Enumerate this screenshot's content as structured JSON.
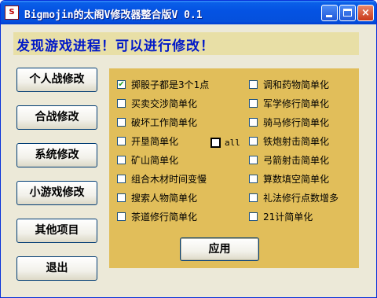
{
  "window": {
    "title": "Bigmojin的太阁V修改器整合版V 0.1",
    "icon_text": "S",
    "buttons": {
      "minimize": "minimize-icon",
      "maximize": "maximize-icon",
      "close": "×"
    }
  },
  "banner": {
    "text": "发现游戏进程！可以进行修改！",
    "color": "#0018C8"
  },
  "sidebar": [
    {
      "label": "个人战修改"
    },
    {
      "label": "合战修改"
    },
    {
      "label": "系统修改"
    },
    {
      "label": "小游戏修改"
    },
    {
      "label": "其他项目"
    },
    {
      "label": "退出"
    }
  ],
  "options_left": [
    {
      "label": "掷骰子都是3个1点",
      "checked": true
    },
    {
      "label": "买卖交涉简单化",
      "checked": false
    },
    {
      "label": "破坏工作简单化",
      "checked": false
    },
    {
      "label": "开垦简单化",
      "checked": false
    },
    {
      "label": "矿山简单化",
      "checked": false
    },
    {
      "label": "组合木材时间变慢",
      "checked": false
    },
    {
      "label": "搜索人物简单化",
      "checked": false
    },
    {
      "label": "茶道修行简单化",
      "checked": false
    }
  ],
  "options_right": [
    {
      "label": "调和药物简单化",
      "checked": false
    },
    {
      "label": "军学修行简单化",
      "checked": false
    },
    {
      "label": "骑马修行简单化",
      "checked": false
    },
    {
      "label": "铁炮射击简单化",
      "checked": false
    },
    {
      "label": "弓箭射击简单化",
      "checked": false
    },
    {
      "label": "算数填空简单化",
      "checked": false
    },
    {
      "label": "礼法修行点数增多",
      "checked": false
    },
    {
      "label": "21计简单化",
      "checked": false
    }
  ],
  "all_option": {
    "label": "all",
    "checked": false
  },
  "apply_button": {
    "label": "应用"
  },
  "colors": {
    "panel": "#E1BE5A",
    "titlebar": "#0553E3",
    "check": "#21A121"
  }
}
